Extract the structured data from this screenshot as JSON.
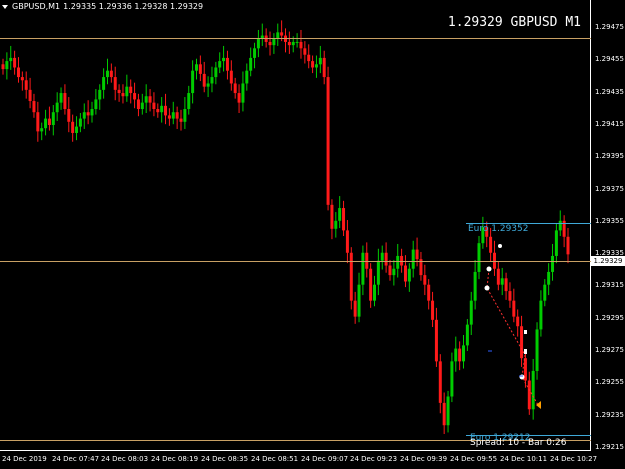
{
  "header": {
    "symbol_info": "GBPUSD,M1",
    "ohlc": "1.29335 1.29336 1.29328 1.29329",
    "big_price": "1.29329",
    "big_symbol": "GBPUSD M1"
  },
  "price_axis": {
    "labels": [
      "1.29475",
      "1.29455",
      "1.29435",
      "1.29415",
      "1.29395",
      "1.29375",
      "1.29355",
      "1.29335",
      "1.29315",
      "1.29295",
      "1.29275",
      "1.29255",
      "1.29235",
      "1.29215"
    ],
    "current_price": "1.29329"
  },
  "time_axis": {
    "labels": [
      "24 Dec 2019",
      "24 Dec 07:47",
      "24 Dec 08:03",
      "24 Dec 08:19",
      "24 Dec 08:35",
      "24 Dec 08:51",
      "24 Dec 09:07",
      "24 Dec 09:23",
      "24 Dec 09:39",
      "24 Dec 09:55",
      "24 Dec 10:11",
      "24 Dec 10:27"
    ]
  },
  "objects": {
    "euro_high_label": "Euro 1.29352",
    "euro_low_label": "Euro 1.29212",
    "spread_text": "Spread: 10  -  Bar  0:26"
  },
  "colors": {
    "background": "#000000",
    "bull": "#00cc00",
    "bear": "#ff1a1a",
    "level_line": "#c8a064",
    "euro_line": "#3fa9d8"
  },
  "chart_data": {
    "type": "candlestick",
    "symbol": "GBPUSD",
    "timeframe": "M1",
    "ylim": [
      1.29209,
      1.29482
    ],
    "last_price": 1.29329,
    "reference_high": 1.29352,
    "reference_low": 1.29212,
    "close_path": [
      1.29445,
      1.2945,
      1.29452,
      1.29446,
      1.2944,
      1.29438,
      1.29432,
      1.29425,
      1.29418,
      1.29406,
      1.29408,
      1.29414,
      1.2941,
      1.29418,
      1.29424,
      1.2943,
      1.2942,
      1.29412,
      1.29405,
      1.29409,
      1.29414,
      1.29418,
      1.29416,
      1.2942,
      1.29426,
      1.29432,
      1.2944,
      1.29444,
      1.2944,
      1.29432,
      1.2943,
      1.29428,
      1.29434,
      1.2943,
      1.29426,
      1.2942,
      1.29424,
      1.29428,
      1.29424,
      1.2942,
      1.29418,
      1.29422,
      1.29416,
      1.29414,
      1.29418,
      1.29414,
      1.29412,
      1.2942,
      1.2943,
      1.29444,
      1.29448,
      1.29442,
      1.29434,
      1.29436,
      1.2944,
      1.29446,
      1.2945,
      1.29452,
      1.29444,
      1.29436,
      1.2943,
      1.29424,
      1.29436,
      1.29444,
      1.29452,
      1.29458,
      1.29464,
      1.29466,
      1.29462,
      1.2946,
      1.29464,
      1.29468,
      1.29466,
      1.29462,
      1.2946,
      1.29462,
      1.29462,
      1.29458,
      1.29454,
      1.2945,
      1.29446,
      1.29448,
      1.29452,
      1.2944,
      1.2936,
      1.29345,
      1.2935,
      1.29358,
      1.29344,
      1.2933,
      1.293,
      1.2929,
      1.2931,
      1.2933,
      1.2932,
      1.293,
      1.2931,
      1.29325,
      1.2933,
      1.29322,
      1.29316,
      1.2932,
      1.29328,
      1.29322,
      1.29312,
      1.2932,
      1.29332,
      1.29326,
      1.29316,
      1.2931,
      1.293,
      1.29288,
      1.29262,
      1.29236,
      1.29222,
      1.2924,
      1.29262,
      1.2927,
      1.29262,
      1.29272,
      1.29285,
      1.293,
      1.29318,
      1.29336,
      1.29346,
      1.2934,
      1.2933,
      1.2932,
      1.2931,
      1.29314,
      1.29306,
      1.293,
      1.2929,
      1.29284,
      1.29264,
      1.2925,
      1.29232,
      1.29256,
      1.29282,
      1.293,
      1.2931,
      1.29318,
      1.29328,
      1.29344,
      1.2935,
      1.2934,
      1.29329
    ]
  }
}
